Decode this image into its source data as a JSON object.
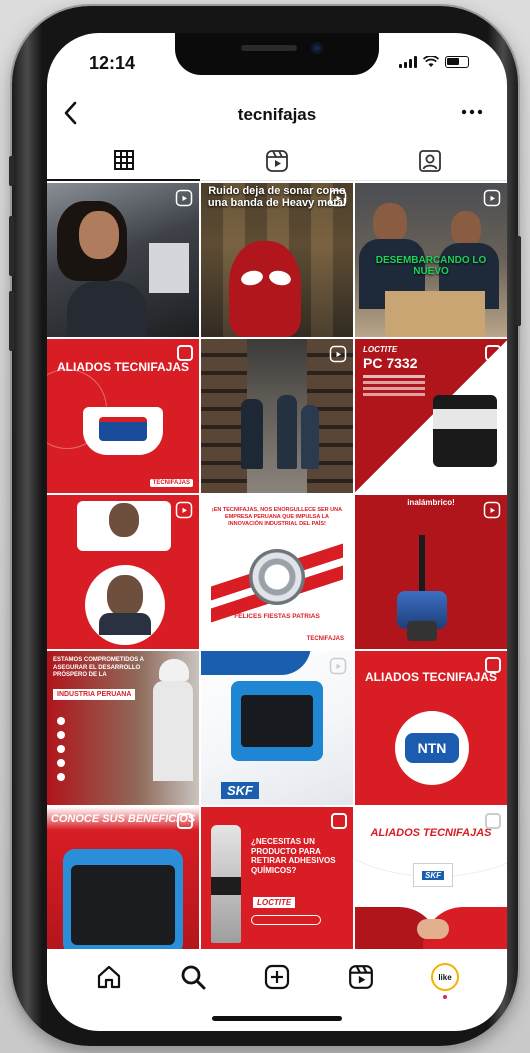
{
  "status_bar": {
    "time": "12:14"
  },
  "header": {
    "username": "tecnifajas"
  },
  "icons": {
    "back": "chevron-left-icon",
    "more": "more-horizontal-icon",
    "tab_grid": "grid-icon",
    "tab_reels": "reels-icon",
    "tab_tagged": "tagged-person-icon",
    "nav_home": "home-icon",
    "nav_search": "search-icon",
    "nav_create": "plus-square-icon",
    "nav_reels": "reels-icon",
    "nav_profile": "avatar-icon"
  },
  "colors": {
    "brand_red": "#d81d24",
    "dark_red": "#a8141a",
    "skf_blue": "#1a5eb0"
  },
  "posts": [
    {
      "text": ""
    },
    {
      "text": "Ruido deja de sonar como una banda de Heavy metal"
    },
    {
      "text": "DESEMBARCANDO LO NUEVO"
    },
    {
      "title": "ALIADOS TECNIFAJAS",
      "tag": "TECNIFAJAS"
    },
    {
      "text": ""
    },
    {
      "brand": "LOCTITE",
      "model": "PC 7332"
    },
    {
      "text": ""
    },
    {
      "headline": "¡EN TECNIFAJAS, NOS ENORGULLECE SER UNA EMPRESA PERUANA QUE IMPULSA LA INNOVACIÓN INDUSTRIAL DEL PAÍS!",
      "footer": "FELICES FIESTAS PATRIAS",
      "tag": "TECNIFAJAS"
    },
    {
      "text": "inalámbrico!"
    },
    {
      "text": "ESTAMOS COMPROMETIDOS A ASEGURAR EL DESARROLLO PRÓSPERO DE LA",
      "highlight": "INDUSTRIA PERUANA"
    },
    {
      "brand": "SKF"
    },
    {
      "title": "ALIADOS TECNIFAJAS",
      "partner": "NTN"
    },
    {
      "title": "CONOCE SUS BENEFICIOS"
    },
    {
      "text": "¿NECESITAS UN PRODUCTO PARA RETIRAR ADHESIVOS QUÍMICOS?",
      "brand": "LOCTITE"
    },
    {
      "title": "ALIADOS TECNIFAJAS",
      "partner": "SKF"
    }
  ],
  "profile": {
    "avatar_label": "like"
  }
}
